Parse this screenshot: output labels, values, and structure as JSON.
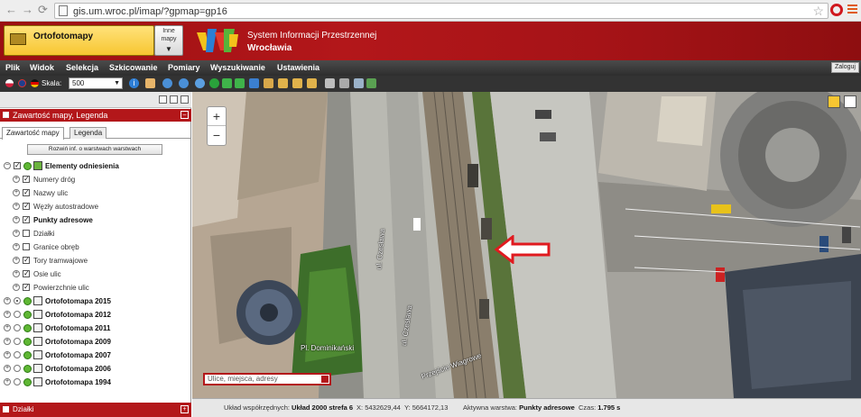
{
  "browser": {
    "back_glyph": "←",
    "forward_glyph": "→",
    "reload_glyph": "⟳",
    "url": "gis.um.wroc.pl/imap/?gpmap=gp16",
    "star_glyph": "☆"
  },
  "header": {
    "layer_name": "Ortofotomapy",
    "inne_label_1": "Inne",
    "inne_label_2": "mapy",
    "inne_arrow": "▼",
    "title": "System Informacji Przestrzennej",
    "subtitle": "Wrocławia"
  },
  "menu": {
    "items": [
      "Plik",
      "Widok",
      "Selekcja",
      "Szkicowanie",
      "Pomiary",
      "Wyszukiwanie",
      "Ustawienia"
    ],
    "login": "Zaloguj"
  },
  "toolbar": {
    "scale_label": "Skala:",
    "scale_value": "500",
    "scale_arrow": "▼"
  },
  "panel": {
    "title": "Zawartość mapy, Legenda",
    "tabs": [
      "Zawartość mapy",
      "Legenda"
    ],
    "expand_button": "Rozwiń inf. o warstwach warstwach",
    "layers": [
      {
        "label": "Elementy odniesienia",
        "bold": true
      },
      {
        "label": "Numery dróg",
        "bold": false
      },
      {
        "label": "Nazwy ulic",
        "bold": false
      },
      {
        "label": "Węzły autostradowe",
        "bold": false
      },
      {
        "label": "Punkty adresowe",
        "bold": true
      },
      {
        "label": "Działki",
        "bold": false
      },
      {
        "label": "Granice obręb",
        "bold": false
      },
      {
        "label": "Tory tramwajowe",
        "bold": false
      },
      {
        "label": "Osie ulic",
        "bold": false
      },
      {
        "label": "Powierzchnie ulic",
        "bold": false
      },
      {
        "label": "Ortofotomapa 2015",
        "bold": true
      },
      {
        "label": "Ortofotomapa 2012",
        "bold": true
      },
      {
        "label": "Ortofotomapa 2011",
        "bold": true
      },
      {
        "label": "Ortofotomapa 2009",
        "bold": true
      },
      {
        "label": "Ortofotomapa 2007",
        "bold": true
      },
      {
        "label": "Ortofotomapa 2006",
        "bold": true
      },
      {
        "label": "Ortofotomapa 1994",
        "bold": true
      }
    ],
    "bottom_title": "Działki"
  },
  "map": {
    "zoom_in": "+",
    "zoom_out": "−",
    "labels": {
      "street1": "ul. Czesława",
      "street2": "ul. Czesława",
      "place": "Pl. Dominikański",
      "crossing": "Przejście Wiagrowe"
    },
    "search_placeholder": "Ulice, miejsca, adresy"
  },
  "status": {
    "system_label": "Układ współrzędnych:",
    "system_value": "Układ 2000 strefa 6",
    "x_label": "X:",
    "x_value": "5432629,44",
    "y_label": "Y:",
    "y_value": "5664172,13",
    "active_label": "Aktywna warstwa:",
    "active_value": "Punkty adresowe",
    "time_label": "Czas:",
    "time_value": "1.795 s"
  },
  "colors": {
    "brand_red": "#b3171a",
    "highlight_yellow": "#f7c631",
    "arrow_red": "#e01a1f"
  }
}
